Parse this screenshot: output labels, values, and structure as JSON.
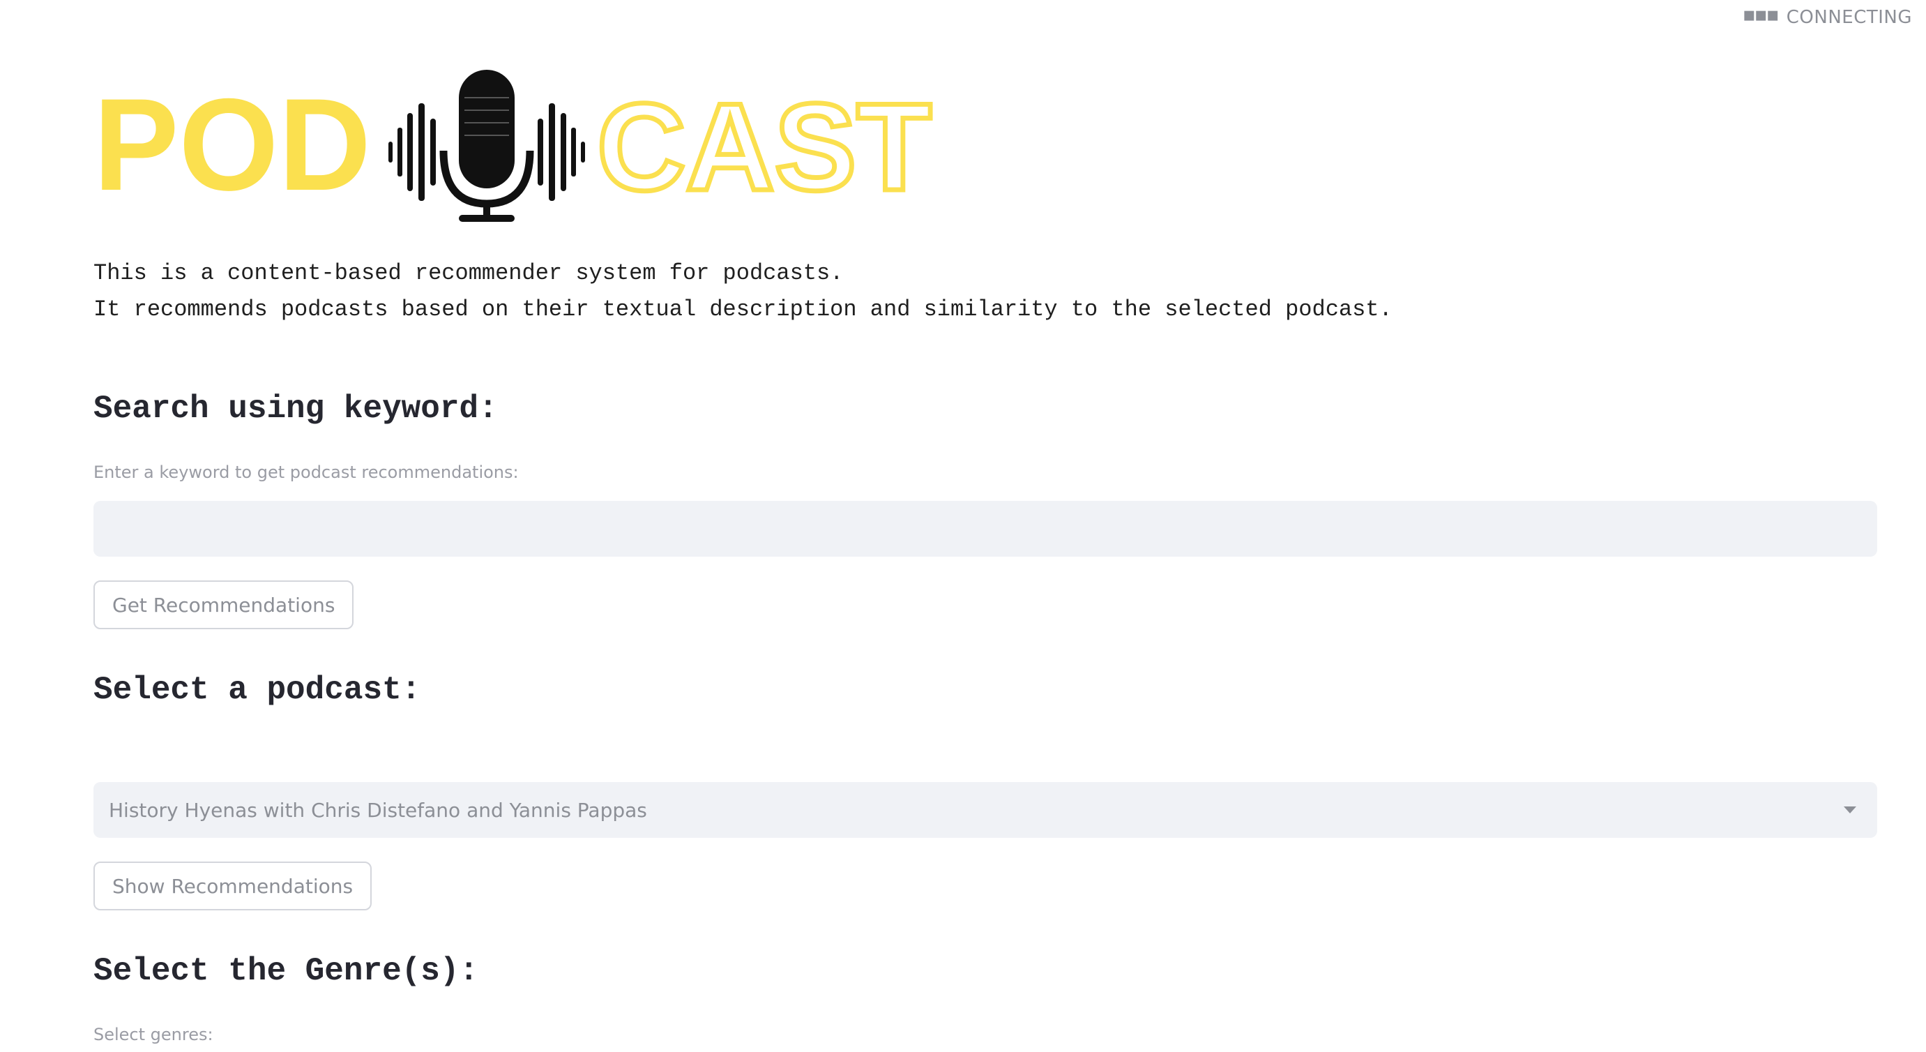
{
  "status": {
    "icon": "dots-icon",
    "text": "CONNECTING"
  },
  "logo": {
    "left_text": "POD",
    "right_text": "CAST",
    "icon": "microphone-soundwave-icon",
    "colors": {
      "yellow": "#FBE04F",
      "mic": "#111111"
    }
  },
  "intro": {
    "line1": "This is a content-based recommender system for podcasts.",
    "line2": "It recommends podcasts based on their textual description and similarity to the selected podcast."
  },
  "keyword_section": {
    "heading": "Search using keyword:",
    "label": "Enter a keyword to get podcast recommendations:",
    "input_value": "",
    "button_label": "Get Recommendations"
  },
  "podcast_section": {
    "heading": "Select a podcast:",
    "selected_value": "History Hyenas with Chris Distefano and Yannis Pappas",
    "button_label": "Show Recommendations"
  },
  "genre_section": {
    "heading": "Select the Genre(s):",
    "label": "Select genres:"
  }
}
